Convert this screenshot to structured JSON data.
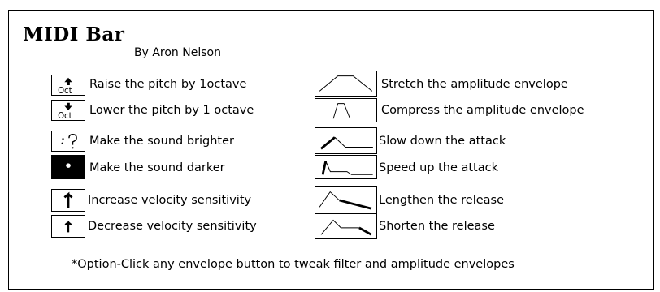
{
  "title": "MIDI Bar",
  "byline": "By Aron Nelson",
  "left_buttons": [
    {
      "label": "Raise the pitch by 1octave",
      "icon": "octave-up-icon",
      "glyph_top": "Oct"
    },
    {
      "label": "Lower the pitch by 1 octave",
      "icon": "octave-down-icon",
      "glyph_top": "Oct"
    },
    {
      "label": "Make the sound brighter",
      "icon": "brighter-icon"
    },
    {
      "label": "Make the sound darker",
      "icon": "darker-icon"
    },
    {
      "label": "Increase velocity sensitivity",
      "icon": "velocity-up-icon"
    },
    {
      "label": "Decrease velocity sensitivity",
      "icon": "velocity-down-icon"
    }
  ],
  "right_buttons": [
    {
      "label": "Stretch the amplitude envelope",
      "icon": "stretch-envelope-icon"
    },
    {
      "label": "Compress the amplitude envelope",
      "icon": "compress-envelope-icon"
    },
    {
      "label": "Slow down the attack",
      "icon": "slow-attack-icon"
    },
    {
      "label": "Speed up the attack",
      "icon": "fast-attack-icon"
    },
    {
      "label": "Lengthen the release",
      "icon": "lengthen-release-icon"
    },
    {
      "label": "Shorten the release",
      "icon": "shorten-release-icon"
    }
  ],
  "footnote": "*Option-Click any envelope button to tweak filter and amplitude envelopes"
}
